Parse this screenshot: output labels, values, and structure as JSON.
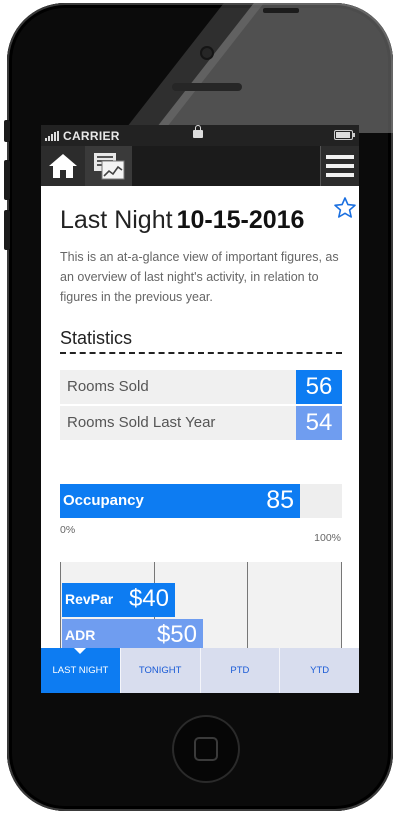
{
  "status_bar": {
    "carrier": "CARRIER"
  },
  "nav": {
    "home_icon": "home-icon",
    "report_icon": "report-icon",
    "menu_icon": "hamburger-menu-icon"
  },
  "page": {
    "title": "Last Night",
    "date": "10-15-2016",
    "favorite_icon": "star-outline-icon",
    "description": "This is an at-a-glance view of important figures, as an overview of last night's activity, in relation to figures in the previous year."
  },
  "statistics": {
    "heading": "Statistics",
    "rows": [
      {
        "label": "Rooms Sold",
        "value": "56",
        "color": "#0d7cf2"
      },
      {
        "label": "Rooms Sold Last Year",
        "value": "54",
        "color": "#6f9df0"
      }
    ]
  },
  "occupancy": {
    "label": "Occupancy",
    "value": "85",
    "fraction": 0.85,
    "min_label": "0%",
    "max_label": "100%",
    "color": "#0d7cf2"
  },
  "revenue": {
    "bars": [
      {
        "label": "RevPar",
        "value": "$40",
        "fraction": 0.4
      },
      {
        "label": "ADR",
        "value": "$50",
        "fraction": 0.5
      }
    ]
  },
  "tabs": [
    {
      "label": "LAST NIGHT",
      "active": true
    },
    {
      "label": "TONIGHT",
      "active": false
    },
    {
      "label": "PTD",
      "active": false
    },
    {
      "label": "YTD",
      "active": false
    }
  ],
  "colors": {
    "accent": "#0d7cf2",
    "accent_light": "#6f9df0",
    "tab_bg": "#d8ddee",
    "nav_bg": "#1b1b1b"
  }
}
